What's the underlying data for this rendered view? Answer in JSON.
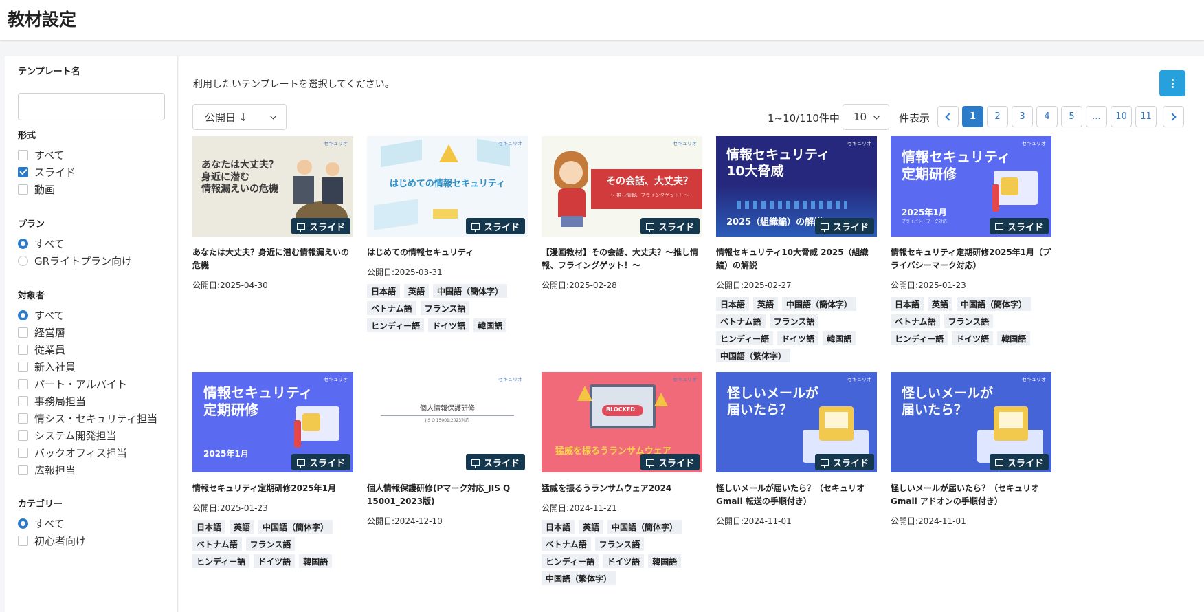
{
  "header": {
    "title": "教材設定"
  },
  "sidebar": {
    "template_name_label": "テンプレート名",
    "template_name_value": "",
    "format": {
      "label": "形式",
      "options": [
        {
          "label": "すべて",
          "checked": false
        },
        {
          "label": "スライド",
          "checked": true
        },
        {
          "label": "動画",
          "checked": false
        }
      ]
    },
    "plan": {
      "label": "プラン",
      "options": [
        {
          "label": "すべて",
          "checked": true
        },
        {
          "label": "GRライトプラン向け",
          "checked": false
        }
      ]
    },
    "audience": {
      "label": "対象者",
      "options": [
        {
          "label": "すべて",
          "checked": true
        },
        {
          "label": "経営層",
          "checked": false
        },
        {
          "label": "従業員",
          "checked": false
        },
        {
          "label": "新入社員",
          "checked": false
        },
        {
          "label": "パート・アルバイト",
          "checked": false
        },
        {
          "label": "事務局担当",
          "checked": false
        },
        {
          "label": "情シス・セキュリティ担当",
          "checked": false
        },
        {
          "label": "システム開発担当",
          "checked": false
        },
        {
          "label": "バックオフィス担当",
          "checked": false
        },
        {
          "label": "広報担当",
          "checked": false
        }
      ]
    },
    "category": {
      "label": "カテゴリー",
      "options": [
        {
          "label": "すべて",
          "checked": true
        },
        {
          "label": "初心者向け",
          "checked": false
        }
      ]
    }
  },
  "main": {
    "instruction": "利用したいテンプレートを選択してください。",
    "sort_value": "公開日 ↓",
    "range_text": "1~10/110件中",
    "per_page_value": "10",
    "per_page_suffix": "件表示",
    "pagination": {
      "pages": [
        "1",
        "2",
        "3",
        "4",
        "5",
        "...",
        "10",
        "11"
      ],
      "current": "1"
    },
    "badge_label": "スライド",
    "brand": "セキュリオ",
    "cards": [
      {
        "thumb_title": "あなたは大丈夫？\n身近に潜む\n情報漏えいの危機",
        "title": "あなたは大丈夫？身近に潜む情報漏えいの危機",
        "date": "公開日:2025-04-30",
        "tags": []
      },
      {
        "thumb_title": "はじめての情報セキュリティ",
        "title": "はじめての情報セキュリティ",
        "date": "公開日:2025-03-31",
        "tags": [
          "日本語",
          "英語",
          "中国語（簡体字）",
          "ベトナム語",
          "フランス語",
          "ヒンディー語",
          "ドイツ語",
          "韓国語"
        ]
      },
      {
        "thumb_title": "その会話、大丈夫？",
        "thumb_sub": "〜 推し情報、フライングゲット！〜",
        "title": "【漫画教材】その会話、大丈夫？～推し情報、フライングゲット！～",
        "date": "公開日:2025-02-28",
        "tags": []
      },
      {
        "thumb_title": "情報セキュリティ\n10大脅威",
        "thumb_sub": "2025（組織編）の解説",
        "title": "情報セキュリティ10大脅威 2025（組織編）の解説",
        "date": "公開日:2025-02-27",
        "tags": [
          "日本語",
          "英語",
          "中国語（簡体字）",
          "ベトナム語",
          "フランス語",
          "ヒンディー語",
          "ドイツ語",
          "韓国語",
          "中国語（繁体字）"
        ]
      },
      {
        "thumb_title": "情報セキュリティ\n定期研修",
        "thumb_sub": "2025年1月",
        "thumb_note": "プライバシーマーク対応",
        "title": "情報セキュリティ定期研修2025年1月（プライバシーマーク対応）",
        "date": "公開日:2025-01-23",
        "tags": [
          "日本語",
          "英語",
          "中国語（簡体字）",
          "ベトナム語",
          "フランス語",
          "ヒンディー語",
          "ドイツ語",
          "韓国語"
        ]
      },
      {
        "thumb_title": "情報セキュリティ\n定期研修",
        "thumb_sub": "2025年1月",
        "title": "情報セキュリティ定期研修2025年1月",
        "date": "公開日:2025-01-23",
        "tags": [
          "日本語",
          "英語",
          "中国語（簡体字）",
          "ベトナム語",
          "フランス語",
          "ヒンディー語",
          "ドイツ語",
          "韓国語"
        ]
      },
      {
        "thumb_title": "個人情報保護研修",
        "thumb_sub": "JIS Q 15001:2023対応",
        "title": "個人情報保護研修(Pマーク対応_JIS Q 15001_2023版)",
        "date": "公開日:2024-12-10",
        "tags": []
      },
      {
        "thumb_title": "猛威を振るうランサムウェア",
        "thumb_sub": "BLOCKED",
        "title": "猛威を振るうランサムウェア2024",
        "date": "公開日:2024-11-21",
        "tags": [
          "日本語",
          "英語",
          "中国語（簡体字）",
          "ベトナム語",
          "フランス語",
          "ヒンディー語",
          "ドイツ語",
          "韓国語",
          "中国語（繁体字）"
        ]
      },
      {
        "thumb_title": "怪しいメールが\n届いたら？",
        "title": "怪しいメールが届いたら？（セキュリオ Gmail 転送の手順付き）",
        "date": "公開日:2024-11-01",
        "tags": []
      },
      {
        "thumb_title": "怪しいメールが\n届いたら？",
        "title": "怪しいメールが届いたら？（セキュリオ Gmail アドオンの手順付き）",
        "date": "公開日:2024-11-01",
        "tags": []
      }
    ]
  },
  "colors": {
    "accent": "#2b7bc9",
    "menu_button": "#26a1de",
    "badge": "#16384f",
    "tag_bg": "#eceff3"
  }
}
